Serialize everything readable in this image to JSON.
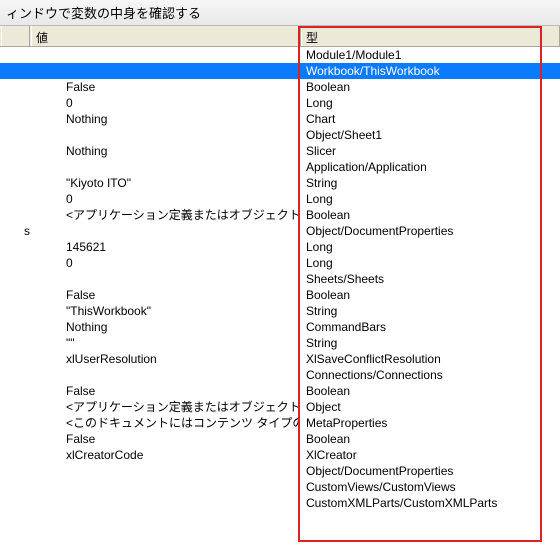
{
  "title": "ィンドウで変数の中身を確認する",
  "headers": {
    "value": "値",
    "type": "型"
  },
  "rows": [
    {
      "value": "",
      "type": "Module1/Module1",
      "selected": false
    },
    {
      "value": "",
      "type": "Workbook/ThisWorkbook",
      "selected": true
    },
    {
      "value": "False",
      "type": "Boolean",
      "selected": false
    },
    {
      "value": "0",
      "type": "Long",
      "selected": false
    },
    {
      "value": "Nothing",
      "type": "Chart",
      "selected": false
    },
    {
      "value": "",
      "type": "Object/Sheet1",
      "selected": false
    },
    {
      "value": "Nothing",
      "type": "Slicer",
      "selected": false
    },
    {
      "value": "",
      "type": "Application/Application",
      "selected": false
    },
    {
      "value": "\"Kiyoto ITO\"",
      "type": "String",
      "selected": false
    },
    {
      "value": "0",
      "type": "Long",
      "selected": false
    },
    {
      "value": "<アプリケーション定義またはオブジェクト定",
      "type": "Boolean",
      "selected": false
    },
    {
      "value": "",
      "type": "Object/DocumentProperties",
      "selected": false,
      "prefix": "s"
    },
    {
      "value": "145621",
      "type": "Long",
      "selected": false
    },
    {
      "value": "0",
      "type": "Long",
      "selected": false
    },
    {
      "value": "",
      "type": "Sheets/Sheets",
      "selected": false
    },
    {
      "value": "False",
      "type": "Boolean",
      "selected": false
    },
    {
      "value": "\"ThisWorkbook\"",
      "type": "String",
      "selected": false
    },
    {
      "value": "Nothing",
      "type": "CommandBars",
      "selected": false
    },
    {
      "value": "\"\"",
      "type": "String",
      "selected": false
    },
    {
      "value": "xlUserResolution",
      "type": "XlSaveConflictResolution",
      "selected": false
    },
    {
      "value": "",
      "type": "Connections/Connections",
      "selected": false
    },
    {
      "value": "False",
      "type": "Boolean",
      "selected": false
    },
    {
      "value": "<アプリケーション定義またはオブジェクト定",
      "type": "Object",
      "selected": false
    },
    {
      "value": "<このドキュメントにはコンテンツ タイプの",
      "type": "MetaProperties",
      "selected": false
    },
    {
      "value": "False",
      "type": "Boolean",
      "selected": false
    },
    {
      "value": "xlCreatorCode",
      "type": "XlCreator",
      "selected": false
    },
    {
      "value": "",
      "type": "Object/DocumentProperties",
      "selected": false
    },
    {
      "value": "",
      "type": "CustomViews/CustomViews",
      "selected": false
    },
    {
      "value": "",
      "type": "CustomXMLParts/CustomXMLParts",
      "selected": false
    }
  ]
}
